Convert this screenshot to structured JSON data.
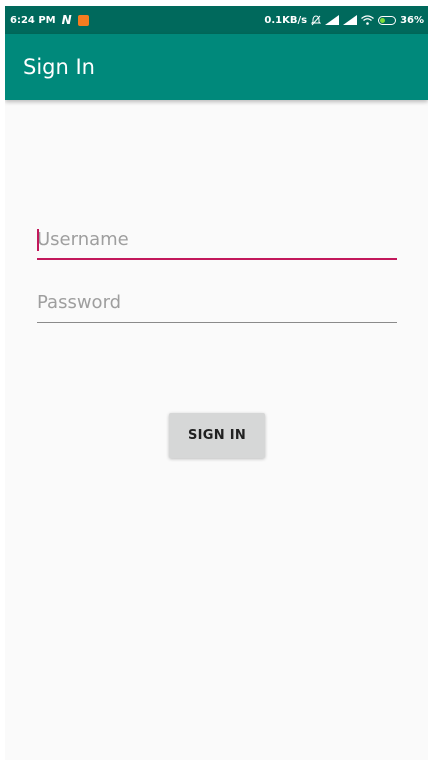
{
  "status_bar": {
    "time": "6:24 PM",
    "n_icon": "N",
    "network_speed": "0.1KB/s",
    "battery_percent": "36%",
    "battery_level": 0.36,
    "background": "#00695c"
  },
  "app_bar": {
    "title": "Sign In",
    "background": "#00897b"
  },
  "form": {
    "username": {
      "placeholder": "Username",
      "value": "",
      "focused": true
    },
    "password": {
      "placeholder": "Password",
      "value": ""
    },
    "accent_color": "#c2185b"
  },
  "actions": {
    "signin_label": "SIGN IN"
  },
  "icons": [
    "n-icon",
    "notification-icon",
    "mute-icon",
    "signal-icon",
    "wifi-icon",
    "battery-icon"
  ]
}
